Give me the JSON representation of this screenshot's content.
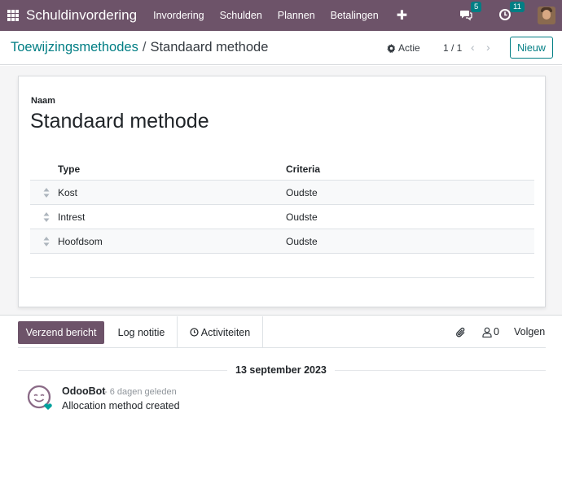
{
  "navbar": {
    "app_name": "Schuldinvordering",
    "menu": [
      "Invordering",
      "Schulden",
      "Plannen",
      "Betalingen"
    ],
    "messages_count": "5",
    "activities_count": "11",
    "colors": {
      "primary": "#6d5369",
      "badge": "#017e84"
    }
  },
  "control": {
    "breadcrumb_parent": "Toewijzingsmethodes",
    "breadcrumb_separator": "/",
    "breadcrumb_current": "Standaard methode",
    "action_label": "Actie",
    "pager": "1 / 1",
    "new_label": "Nieuw"
  },
  "form": {
    "name_label": "Naam",
    "name_value": "Standaard methode",
    "table": {
      "headers": {
        "type": "Type",
        "criteria": "Criteria"
      },
      "rows": [
        {
          "type": "Kost",
          "criteria": "Oudste"
        },
        {
          "type": "Intrest",
          "criteria": "Oudste"
        },
        {
          "type": "Hoofdsom",
          "criteria": "Oudste"
        }
      ]
    }
  },
  "chatter": {
    "send_label": "Verzend bericht",
    "log_label": "Log notitie",
    "activities_label": "Activiteiten",
    "followers_count": "0",
    "follow_label": "Volgen",
    "date": "13 september 2023",
    "message": {
      "author": "OdooBot",
      "time": "- 6 dagen geleden",
      "body": "Allocation method created"
    }
  }
}
